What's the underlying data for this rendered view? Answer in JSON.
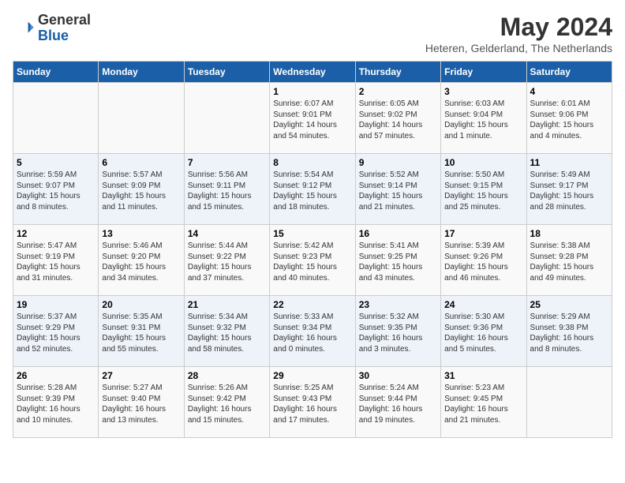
{
  "header": {
    "logo_general": "General",
    "logo_blue": "Blue",
    "month_year": "May 2024",
    "location": "Heteren, Gelderland, The Netherlands"
  },
  "days_of_week": [
    "Sunday",
    "Monday",
    "Tuesday",
    "Wednesday",
    "Thursday",
    "Friday",
    "Saturday"
  ],
  "weeks": [
    [
      {
        "day": "",
        "detail": ""
      },
      {
        "day": "",
        "detail": ""
      },
      {
        "day": "",
        "detail": ""
      },
      {
        "day": "1",
        "detail": "Sunrise: 6:07 AM\nSunset: 9:01 PM\nDaylight: 14 hours\nand 54 minutes."
      },
      {
        "day": "2",
        "detail": "Sunrise: 6:05 AM\nSunset: 9:02 PM\nDaylight: 14 hours\nand 57 minutes."
      },
      {
        "day": "3",
        "detail": "Sunrise: 6:03 AM\nSunset: 9:04 PM\nDaylight: 15 hours\nand 1 minute."
      },
      {
        "day": "4",
        "detail": "Sunrise: 6:01 AM\nSunset: 9:06 PM\nDaylight: 15 hours\nand 4 minutes."
      }
    ],
    [
      {
        "day": "5",
        "detail": "Sunrise: 5:59 AM\nSunset: 9:07 PM\nDaylight: 15 hours\nand 8 minutes."
      },
      {
        "day": "6",
        "detail": "Sunrise: 5:57 AM\nSunset: 9:09 PM\nDaylight: 15 hours\nand 11 minutes."
      },
      {
        "day": "7",
        "detail": "Sunrise: 5:56 AM\nSunset: 9:11 PM\nDaylight: 15 hours\nand 15 minutes."
      },
      {
        "day": "8",
        "detail": "Sunrise: 5:54 AM\nSunset: 9:12 PM\nDaylight: 15 hours\nand 18 minutes."
      },
      {
        "day": "9",
        "detail": "Sunrise: 5:52 AM\nSunset: 9:14 PM\nDaylight: 15 hours\nand 21 minutes."
      },
      {
        "day": "10",
        "detail": "Sunrise: 5:50 AM\nSunset: 9:15 PM\nDaylight: 15 hours\nand 25 minutes."
      },
      {
        "day": "11",
        "detail": "Sunrise: 5:49 AM\nSunset: 9:17 PM\nDaylight: 15 hours\nand 28 minutes."
      }
    ],
    [
      {
        "day": "12",
        "detail": "Sunrise: 5:47 AM\nSunset: 9:19 PM\nDaylight: 15 hours\nand 31 minutes."
      },
      {
        "day": "13",
        "detail": "Sunrise: 5:46 AM\nSunset: 9:20 PM\nDaylight: 15 hours\nand 34 minutes."
      },
      {
        "day": "14",
        "detail": "Sunrise: 5:44 AM\nSunset: 9:22 PM\nDaylight: 15 hours\nand 37 minutes."
      },
      {
        "day": "15",
        "detail": "Sunrise: 5:42 AM\nSunset: 9:23 PM\nDaylight: 15 hours\nand 40 minutes."
      },
      {
        "day": "16",
        "detail": "Sunrise: 5:41 AM\nSunset: 9:25 PM\nDaylight: 15 hours\nand 43 minutes."
      },
      {
        "day": "17",
        "detail": "Sunrise: 5:39 AM\nSunset: 9:26 PM\nDaylight: 15 hours\nand 46 minutes."
      },
      {
        "day": "18",
        "detail": "Sunrise: 5:38 AM\nSunset: 9:28 PM\nDaylight: 15 hours\nand 49 minutes."
      }
    ],
    [
      {
        "day": "19",
        "detail": "Sunrise: 5:37 AM\nSunset: 9:29 PM\nDaylight: 15 hours\nand 52 minutes."
      },
      {
        "day": "20",
        "detail": "Sunrise: 5:35 AM\nSunset: 9:31 PM\nDaylight: 15 hours\nand 55 minutes."
      },
      {
        "day": "21",
        "detail": "Sunrise: 5:34 AM\nSunset: 9:32 PM\nDaylight: 15 hours\nand 58 minutes."
      },
      {
        "day": "22",
        "detail": "Sunrise: 5:33 AM\nSunset: 9:34 PM\nDaylight: 16 hours\nand 0 minutes."
      },
      {
        "day": "23",
        "detail": "Sunrise: 5:32 AM\nSunset: 9:35 PM\nDaylight: 16 hours\nand 3 minutes."
      },
      {
        "day": "24",
        "detail": "Sunrise: 5:30 AM\nSunset: 9:36 PM\nDaylight: 16 hours\nand 5 minutes."
      },
      {
        "day": "25",
        "detail": "Sunrise: 5:29 AM\nSunset: 9:38 PM\nDaylight: 16 hours\nand 8 minutes."
      }
    ],
    [
      {
        "day": "26",
        "detail": "Sunrise: 5:28 AM\nSunset: 9:39 PM\nDaylight: 16 hours\nand 10 minutes."
      },
      {
        "day": "27",
        "detail": "Sunrise: 5:27 AM\nSunset: 9:40 PM\nDaylight: 16 hours\nand 13 minutes."
      },
      {
        "day": "28",
        "detail": "Sunrise: 5:26 AM\nSunset: 9:42 PM\nDaylight: 16 hours\nand 15 minutes."
      },
      {
        "day": "29",
        "detail": "Sunrise: 5:25 AM\nSunset: 9:43 PM\nDaylight: 16 hours\nand 17 minutes."
      },
      {
        "day": "30",
        "detail": "Sunrise: 5:24 AM\nSunset: 9:44 PM\nDaylight: 16 hours\nand 19 minutes."
      },
      {
        "day": "31",
        "detail": "Sunrise: 5:23 AM\nSunset: 9:45 PM\nDaylight: 16 hours\nand 21 minutes."
      },
      {
        "day": "",
        "detail": ""
      }
    ]
  ]
}
